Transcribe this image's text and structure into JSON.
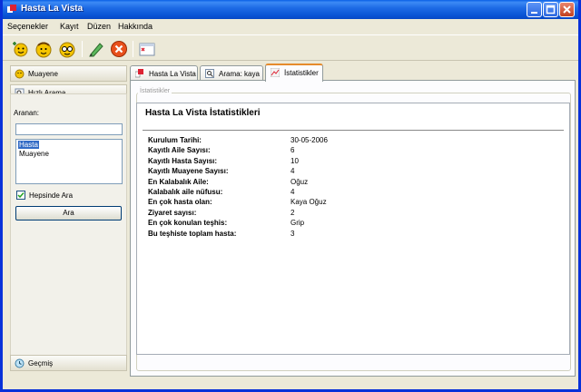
{
  "window": {
    "title": "Hasta La Vista"
  },
  "menu": [
    "Seçenekler",
    "Kayıt",
    "Düzen",
    "Hakkında"
  ],
  "toolbar": {
    "icons": [
      "add-family-icon",
      "add-patient-icon",
      "add-exam-icon",
      "edit-icon",
      "delete-icon",
      "close-tab-icon"
    ]
  },
  "left": {
    "nav_muayene": "Muayene",
    "nav_hizli_arama": "Hızlı Arama",
    "search_label": "Aranan:",
    "search_value": "",
    "list_options": [
      "Hasta",
      "Muayene"
    ],
    "selected_option": "Hasta",
    "checkbox_label": "Hepsinde Ara",
    "checkbox_checked": true,
    "search_button": "Ara",
    "gecmis": "Geçmiş"
  },
  "tabs": [
    {
      "label": "Hasta La Vista",
      "icon": "app-icon",
      "active": false
    },
    {
      "label": "Arama: kaya",
      "icon": "search-icon",
      "active": false
    },
    {
      "label": "İstatistikler",
      "icon": "stats-icon",
      "active": true
    }
  ],
  "stats": {
    "group_legend": "İstatistikler",
    "title": "Hasta La Vista İstatistikleri",
    "rows": [
      {
        "key": "Kurulum Tarihi:",
        "value": "30-05-2006"
      },
      {
        "key": "Kayıtlı Aile Sayısı:",
        "value": "6"
      },
      {
        "key": "Kayıtlı Hasta Sayısı:",
        "value": "10"
      },
      {
        "key": "Kayıtlı Muayene Sayısı:",
        "value": "4"
      },
      {
        "key": "En Kalabalık Aile:",
        "value": "Oğuz"
      },
      {
        "key": "Kalabalık aile nüfusu:",
        "value": "4"
      },
      {
        "key": "En çok hasta olan:",
        "value": "Kaya Oğuz"
      },
      {
        "key": "Ziyaret sayısı:",
        "value": "2"
      },
      {
        "key": "En çok konulan teşhis:",
        "value": "Grip"
      },
      {
        "key": "Bu teşhiste toplam hasta:",
        "value": "3"
      }
    ]
  }
}
